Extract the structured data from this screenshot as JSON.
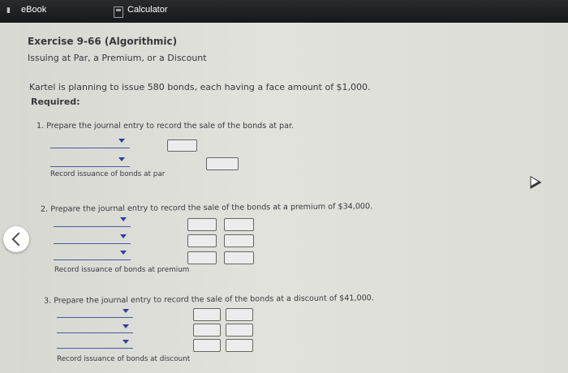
{
  "tabs": {
    "ebook": "eBook",
    "calculator": "Calculator"
  },
  "exercise": {
    "title": "Exercise 9-66 (Algorithmic)",
    "subtitle": "Issuing at Par, a Premium, or a Discount",
    "intro": "Kartel is planning to issue 580 bonds, each having a face amount of $1,000.",
    "required": "Required:"
  },
  "questions": [
    {
      "text": "1. Prepare the journal entry to record the sale of the bonds at par.",
      "caption": "Record issuance of bonds at par"
    },
    {
      "text": "2. Prepare the journal entry to record the sale of the bonds at a premium of $34,000.",
      "caption": "Record issuance of bonds at premium"
    },
    {
      "text": "3. Prepare the journal entry to record the sale of the bonds at a discount of $41,000.",
      "caption": "Record issuance of bonds at discount"
    }
  ],
  "icons": {
    "back": "chevron-left-icon",
    "calculator": "calculator-icon",
    "cursor": "pointer-cursor-icon"
  }
}
